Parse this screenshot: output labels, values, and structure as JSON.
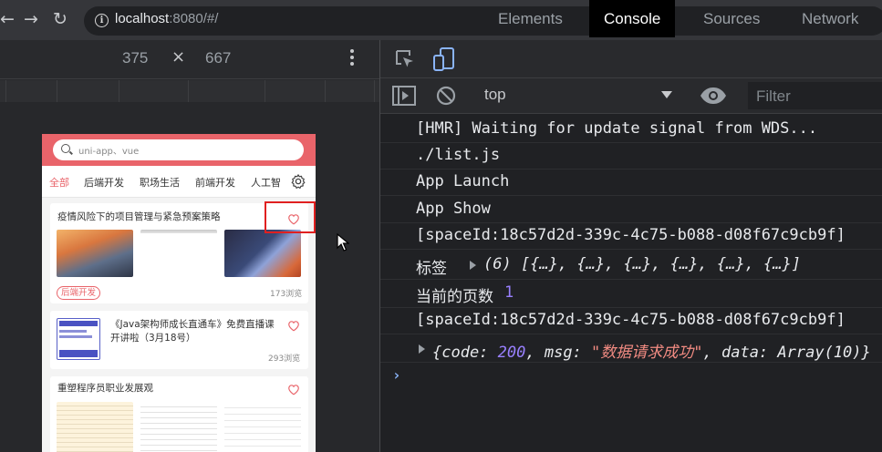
{
  "browser": {
    "url_host": "localhost",
    "url_rest": ":8080/#/"
  },
  "device": {
    "width": "375",
    "times": "×",
    "height": "667"
  },
  "phone": {
    "search_placeholder": "uni-app、vue",
    "tabs": [
      "全部",
      "后端开发",
      "职场生活",
      "前端开发",
      "人工智"
    ],
    "cards": [
      {
        "title": "疫情风险下的项目管理与紧急预案策略",
        "tag": "后端开发",
        "views": "173浏览"
      },
      {
        "title": "《Java架构师成长直通车》免费直播课开讲啦（3月18号）",
        "views": "293浏览"
      },
      {
        "title": "重塑程序员职业发展观"
      }
    ],
    "colors": {
      "accent": "#e9646a"
    }
  },
  "devtools": {
    "tabs": [
      "Elements",
      "Console",
      "Sources",
      "Network"
    ],
    "active_tab": "Console",
    "context": "top",
    "filter_placeholder": "Filter",
    "logs": {
      "l1": "[HMR] Waiting for update signal from WDS...",
      "l2": "./list.js",
      "l3": "App Launch",
      "l4": "App Show",
      "l5": "[spaceId:18c57d2d-339c-4c75-b088-d08f67c9cb9f]",
      "l6_label": "标签",
      "l6_value": "(6) [{…}, {…}, {…}, {…}, {…}, {…}]",
      "l7_label": "当前的页数",
      "l7_value": "1",
      "l8": "[spaceId:18c57d2d-339c-4c75-b088-d08f67c9cb9f]",
      "l9_open": "{code: ",
      "l9_code": "200",
      "l9_mid": ", msg: ",
      "l9_msg": "\"数据请求成功\"",
      "l9_tail": ", data: Array(10)}",
      "prompt": "›"
    }
  }
}
